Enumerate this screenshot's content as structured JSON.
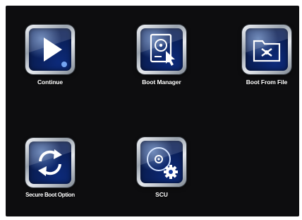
{
  "menu": {
    "items": [
      {
        "label": "Continue",
        "icon": "play-icon"
      },
      {
        "label": "Boot Manager",
        "icon": "disk-cursor-icon"
      },
      {
        "label": "Boot From File",
        "icon": "folder-icon"
      },
      {
        "label": "Secure Boot Option",
        "icon": "refresh-arrows-icon"
      },
      {
        "label": "SCU",
        "icon": "disc-gear-icon"
      }
    ]
  },
  "colors": {
    "background": "#0d0d0f",
    "tile_blue": "#123a9e",
    "label": "#ffffff"
  }
}
